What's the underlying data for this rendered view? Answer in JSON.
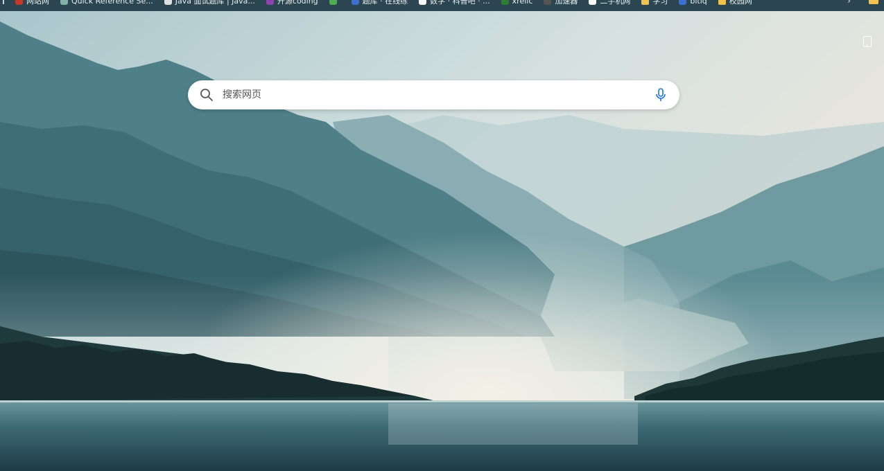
{
  "bookmarks": [
    {
      "label": "网站网",
      "icon": "bookmark-icon",
      "color": "#c0392b"
    },
    {
      "label": "Quick Reference Se...",
      "icon": "bookmark-icon",
      "color": "#7fb3a4"
    },
    {
      "label": "Java 面试题库 | Java...",
      "icon": "bookmark-icon",
      "color": "#e0e0e0"
    },
    {
      "label": "开源coding",
      "icon": "bookmark-icon",
      "color": "#8e44ad"
    },
    {
      "label": "",
      "icon": "bookmark-icon",
      "color": "#4caf50"
    },
    {
      "label": "题库 · 在线练",
      "icon": "bookmark-icon",
      "color": "#3b6fd1"
    },
    {
      "label": "数学 · 科普吧 · ...",
      "icon": "bookmark-icon",
      "color": "#ffffff"
    },
    {
      "label": "xrelic",
      "icon": "bookmark-icon",
      "color": "#2e7d32"
    },
    {
      "label": "加速器",
      "icon": "bookmark-icon",
      "color": "#555555"
    },
    {
      "label": "二手机网",
      "icon": "bookmark-icon",
      "color": "#ffffff"
    },
    {
      "label": "学习",
      "icon": "folder-icon",
      "color": "#f2c24f"
    },
    {
      "label": "bitiq",
      "icon": "bookmark-icon",
      "color": "#3b6fd1"
    },
    {
      "label": "校园网",
      "icon": "folder-icon",
      "color": "#f2c24f"
    }
  ],
  "search": {
    "placeholder": "搜索网页"
  },
  "colors": {
    "search_icon": "#555555",
    "mic_icon": "#1a73e8"
  }
}
